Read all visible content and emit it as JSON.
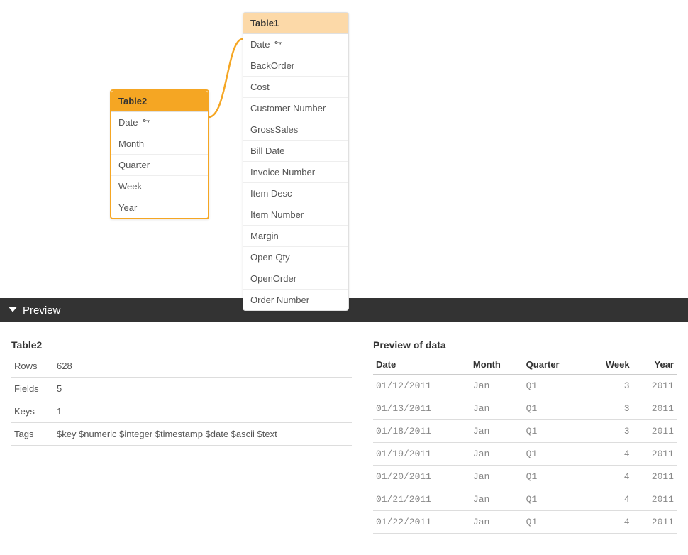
{
  "diagram": {
    "table1": {
      "name": "Table1",
      "fields": [
        {
          "label": "Date",
          "key": true
        },
        {
          "label": "BackOrder",
          "key": false
        },
        {
          "label": "Cost",
          "key": false
        },
        {
          "label": "Customer Number",
          "key": false
        },
        {
          "label": "GrossSales",
          "key": false
        },
        {
          "label": "Bill Date",
          "key": false
        },
        {
          "label": "Invoice Number",
          "key": false
        },
        {
          "label": "Item Desc",
          "key": false
        },
        {
          "label": "Item Number",
          "key": false
        },
        {
          "label": "Margin",
          "key": false
        },
        {
          "label": "Open Qty",
          "key": false
        },
        {
          "label": "OpenOrder",
          "key": false
        },
        {
          "label": "Order Number",
          "key": false
        }
      ]
    },
    "table2": {
      "name": "Table2",
      "fields": [
        {
          "label": "Date",
          "key": true
        },
        {
          "label": "Month",
          "key": false
        },
        {
          "label": "Quarter",
          "key": false
        },
        {
          "label": "Week",
          "key": false
        },
        {
          "label": "Year",
          "key": false
        }
      ]
    }
  },
  "preview": {
    "title": "Preview",
    "meta": {
      "tableName": "Table2",
      "labels": {
        "rows": "Rows",
        "fields": "Fields",
        "keys": "Keys",
        "tags": "Tags"
      },
      "values": {
        "rows": "628",
        "fields": "5",
        "keys": "1",
        "tags": "$key $numeric $integer $timestamp $date $ascii $text"
      }
    },
    "data": {
      "title": "Preview of data",
      "columns": [
        "Date",
        "Month",
        "Quarter",
        "Week",
        "Year"
      ],
      "rows": [
        [
          "01/12/2011",
          "Jan",
          "Q1",
          "3",
          "2011"
        ],
        [
          "01/13/2011",
          "Jan",
          "Q1",
          "3",
          "2011"
        ],
        [
          "01/18/2011",
          "Jan",
          "Q1",
          "3",
          "2011"
        ],
        [
          "01/19/2011",
          "Jan",
          "Q1",
          "4",
          "2011"
        ],
        [
          "01/20/2011",
          "Jan",
          "Q1",
          "4",
          "2011"
        ],
        [
          "01/21/2011",
          "Jan",
          "Q1",
          "4",
          "2011"
        ],
        [
          "01/22/2011",
          "Jan",
          "Q1",
          "4",
          "2011"
        ]
      ]
    }
  }
}
